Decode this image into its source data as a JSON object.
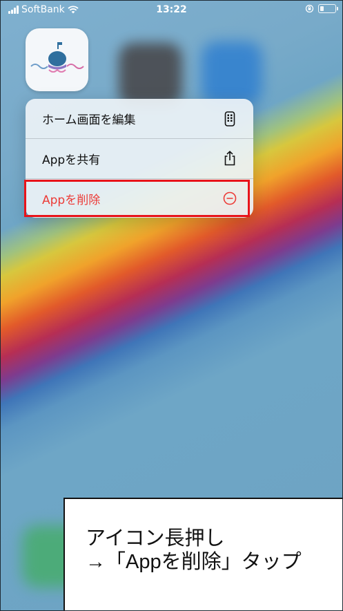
{
  "status_bar": {
    "carrier": "SoftBank",
    "time": "13:22",
    "signal_icon": "signal-bars-icon",
    "wifi_icon": "wifi-icon",
    "lock_icon": "orientation-lock-icon",
    "battery_icon": "battery-icon"
  },
  "home": {
    "app_icon": "whale-app-icon"
  },
  "context_menu": {
    "items": [
      {
        "label": "ホーム画面を編集",
        "icon": "phone-edit-icon"
      },
      {
        "label": "Appを共有",
        "icon": "share-icon"
      },
      {
        "label": "Appを削除",
        "icon": "minus-circle-icon"
      }
    ],
    "destructive_color": "#ec3b37",
    "highlight_color": "#e8131a"
  },
  "caption": {
    "line1": "アイコン長押し",
    "line2": "→「Appを削除」タップ"
  }
}
